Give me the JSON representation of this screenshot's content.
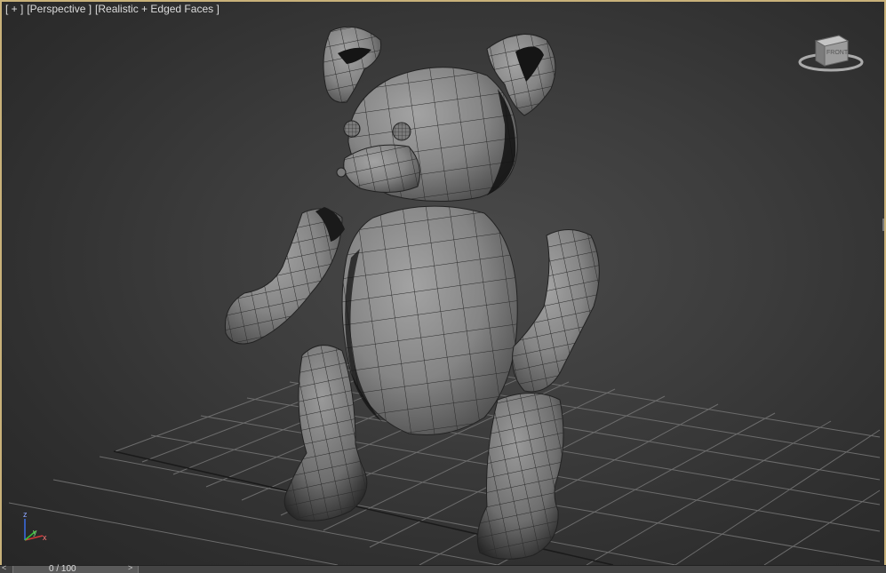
{
  "viewport": {
    "label_plus": "[ + ]",
    "label_view": "[Perspective ]",
    "label_shading": "[Realistic + Edged Faces ]"
  },
  "viewcube": {
    "face_label": "FRONT"
  },
  "axis_tripod": {
    "z": "z",
    "y": "y",
    "x": "x"
  },
  "timeline": {
    "frame_label": "0 / 100",
    "prev_icon": "chevron-left-icon",
    "next_icon": "chevron-right-icon"
  },
  "colors": {
    "border": "#c9b27a",
    "mesh": "#8a8a8a",
    "grid": "#6a6a6a"
  },
  "model": {
    "name": "teddy-bear"
  }
}
